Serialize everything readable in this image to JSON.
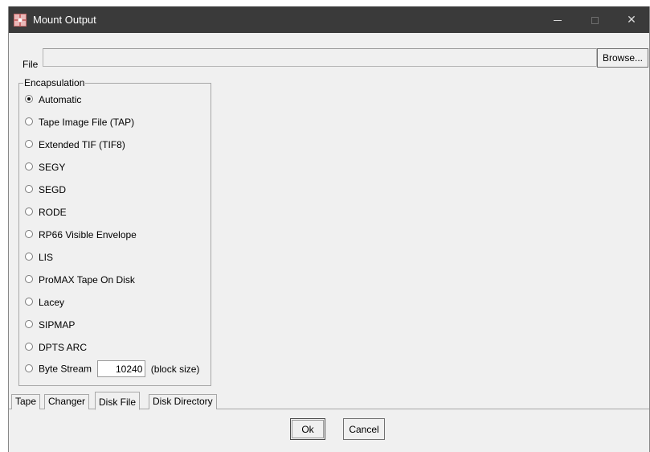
{
  "window": {
    "title": "Mount Output"
  },
  "file": {
    "label": "File",
    "value": "",
    "browse_label": "Browse..."
  },
  "encapsulation": {
    "legend": "Encapsulation",
    "options": [
      {
        "label": "Automatic",
        "checked": true
      },
      {
        "label": "Tape Image File (TAP)",
        "checked": false
      },
      {
        "label": "Extended TIF (TIF8)",
        "checked": false
      },
      {
        "label": "SEGY",
        "checked": false
      },
      {
        "label": "SEGD",
        "checked": false
      },
      {
        "label": "RODE",
        "checked": false
      },
      {
        "label": "RP66 Visible Envelope",
        "checked": false
      },
      {
        "label": "LIS",
        "checked": false
      },
      {
        "label": "ProMAX Tape On Disk",
        "checked": false
      },
      {
        "label": "Lacey",
        "checked": false
      },
      {
        "label": "SIPMAP",
        "checked": false
      },
      {
        "label": "DPTS ARC",
        "checked": false
      },
      {
        "label": "Byte Stream",
        "checked": false
      }
    ],
    "block_size_value": "10240",
    "block_size_suffix": "(block size)"
  },
  "tabs": [
    {
      "label": "Tape",
      "active": false
    },
    {
      "label": "Changer",
      "active": false
    },
    {
      "label": "Disk File",
      "active": true
    },
    {
      "label": "Disk Directory",
      "active": false
    }
  ],
  "buttons": {
    "ok_label": "Ok",
    "cancel_label": "Cancel"
  },
  "colors": {
    "titlebar": "#3a3a3a",
    "dialog_background": "#f0f0f0"
  }
}
